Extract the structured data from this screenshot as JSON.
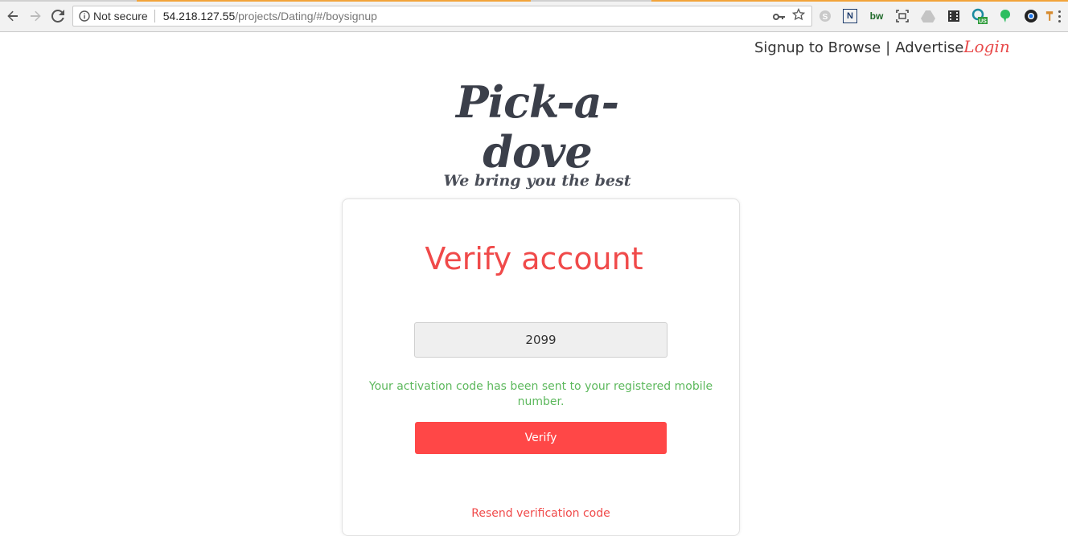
{
  "browser": {
    "secure_label": "Not secure",
    "url_host": "54.218.127.55",
    "url_path": "/projects/Dating/#/boysignup",
    "extensions": [
      "skype-icon",
      "n-icon",
      "bw-icon",
      "screenshot-icon",
      "drive-icon",
      "film-icon",
      "vpn-icon",
      "evernote-icon",
      "chrome-icon",
      "hammer-icon"
    ],
    "ext_bw_label": "bw",
    "ext_n_label": "N",
    "ext_vpn_badge": "US"
  },
  "header": {
    "signup_label": "Signup to Browse",
    "separator": "|",
    "advertise_label": "Advertise",
    "login_label": "Login"
  },
  "logo": {
    "title": "Pick-a-dove",
    "tagline": "We bring you the best"
  },
  "verify": {
    "title": "Verify account",
    "code_value": "2099",
    "message": "Your activation code has been sent to your registered mobile number.",
    "button_label": "Verify",
    "resend_label": "Resend verification code"
  },
  "colors": {
    "accent": "#ff4747",
    "success": "#5cb85c",
    "logo": "#3b3f4a"
  }
}
